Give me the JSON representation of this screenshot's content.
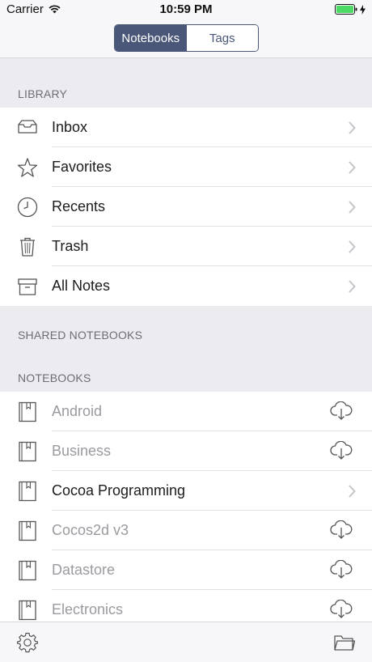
{
  "status": {
    "carrier": "Carrier",
    "time": "10:59 PM"
  },
  "segmented": {
    "notebooks": "Notebooks",
    "tags": "Tags"
  },
  "sections": {
    "library": "LIBRARY",
    "shared": "SHARED NOTEBOOKS",
    "notebooks": "NOTEBOOKS"
  },
  "library": [
    {
      "label": "Inbox",
      "icon": "inbox-icon"
    },
    {
      "label": "Favorites",
      "icon": "star-icon"
    },
    {
      "label": "Recents",
      "icon": "clock-icon"
    },
    {
      "label": "Trash",
      "icon": "trash-icon"
    },
    {
      "label": "All Notes",
      "icon": "archive-box-icon"
    }
  ],
  "notebooks": [
    {
      "label": "Android",
      "state": "cloud"
    },
    {
      "label": "Business",
      "state": "cloud"
    },
    {
      "label": "Cocoa Programming",
      "state": "local"
    },
    {
      "label": "Cocos2d v3",
      "state": "cloud"
    },
    {
      "label": "Datastore",
      "state": "cloud"
    },
    {
      "label": "Electronics",
      "state": "cloud"
    }
  ],
  "colors": {
    "accent": "#4a5778",
    "dimText": "#9a9aa0",
    "battery": "#4cd964"
  }
}
